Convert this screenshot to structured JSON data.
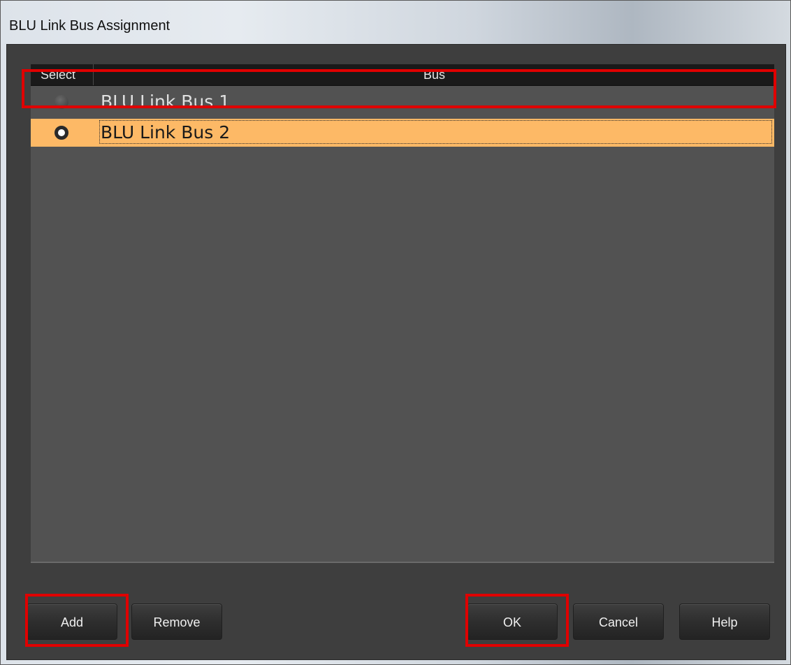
{
  "window": {
    "title": "BLU Link Bus Assignment"
  },
  "list": {
    "columns": {
      "select": "Select",
      "bus": "Bus"
    },
    "rows": [
      {
        "label": "BLU Link Bus 1",
        "selected": false
      },
      {
        "label": "BLU Link Bus 2",
        "selected": true
      }
    ]
  },
  "buttons": {
    "add": "Add",
    "remove": "Remove",
    "ok": "OK",
    "cancel": "Cancel",
    "help": "Help"
  },
  "colors": {
    "selected_row": "#fdb966",
    "highlight": "#e00000",
    "panel": "#525252",
    "header": "#1a1a1a"
  }
}
